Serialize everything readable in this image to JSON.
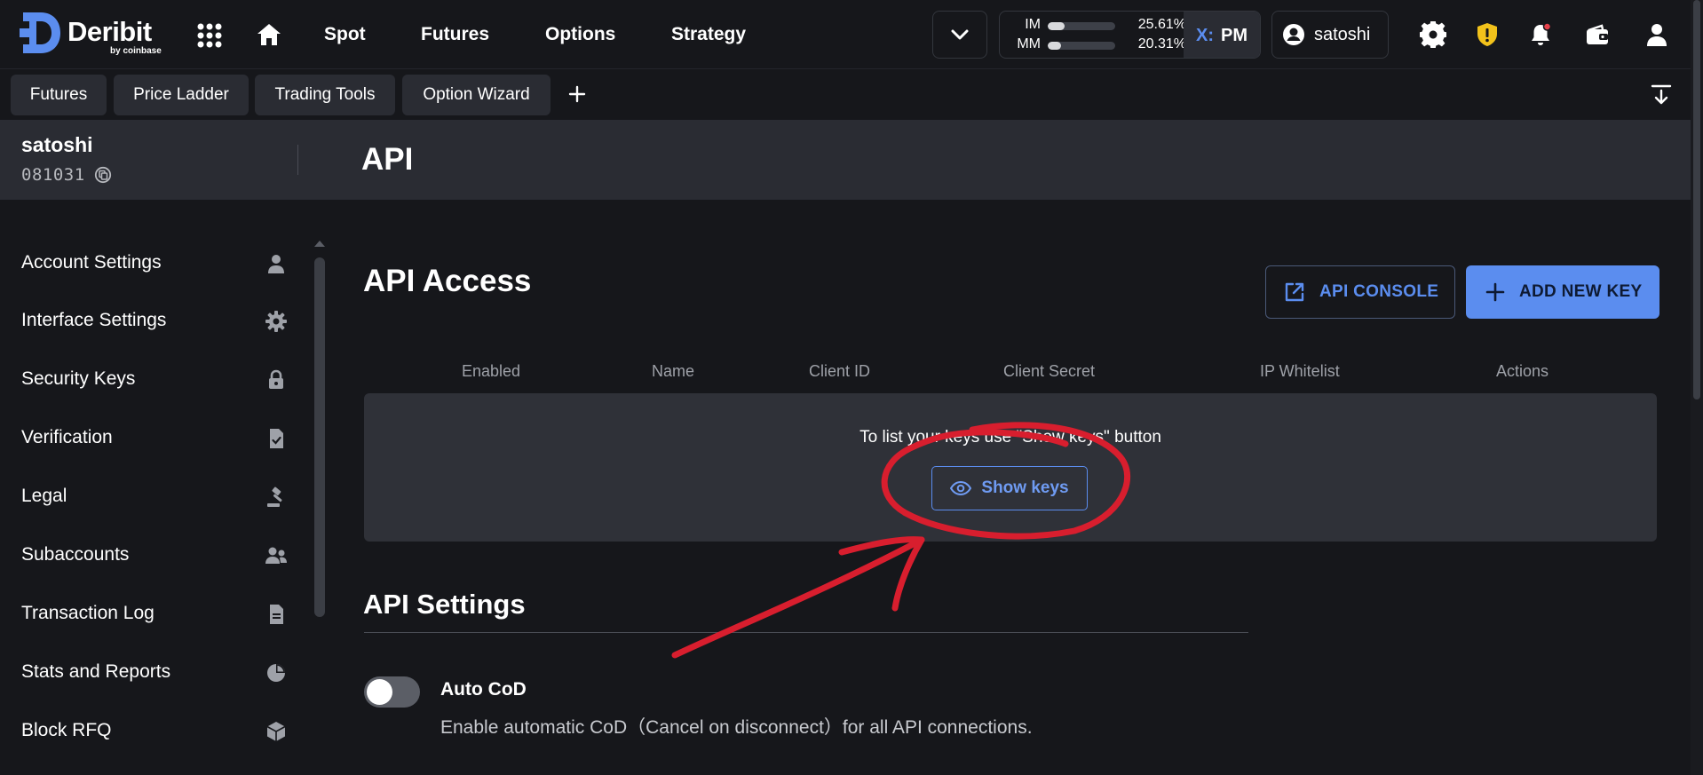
{
  "brand": {
    "name": "Deribit",
    "byline": "by coinbase",
    "accent": "#5b8def"
  },
  "nav": {
    "links": [
      "Spot",
      "Futures",
      "Options",
      "Strategy"
    ]
  },
  "margin": {
    "im_label": "IM",
    "im_value": "25.61%",
    "im_fill": 0.2561,
    "mm_label": "MM",
    "mm_value": "20.31%",
    "mm_fill": 0.2031,
    "mode_prefix": "X:",
    "mode": "PM"
  },
  "user": {
    "name": "satoshi"
  },
  "tabs": [
    "Futures",
    "Price Ladder",
    "Trading Tools",
    "Option Wizard"
  ],
  "account": {
    "name": "satoshi",
    "id": "081031"
  },
  "page": {
    "title": "API"
  },
  "sidebar": {
    "items": [
      {
        "label": "Account Settings",
        "icon": "user-icon"
      },
      {
        "label": "Interface Settings",
        "icon": "gear-icon"
      },
      {
        "label": "Security Keys",
        "icon": "lock-icon"
      },
      {
        "label": "Verification",
        "icon": "checked-document-icon"
      },
      {
        "label": "Legal",
        "icon": "gavel-icon"
      },
      {
        "label": "Subaccounts",
        "icon": "users-icon"
      },
      {
        "label": "Transaction Log",
        "icon": "document-icon"
      },
      {
        "label": "Stats and Reports",
        "icon": "pie-chart-icon"
      },
      {
        "label": "Block RFQ",
        "icon": "cube-icon"
      }
    ]
  },
  "api_access": {
    "title": "API Access",
    "console_label": "API CONSOLE",
    "add_label": "ADD NEW KEY",
    "columns": [
      "Enabled",
      "Name",
      "Client ID",
      "Client Secret",
      "IP Whitelist",
      "Actions"
    ],
    "empty_message": "To list your keys use \"Show keys\" button",
    "show_keys_label": "Show keys"
  },
  "api_settings": {
    "title": "API Settings",
    "auto_cod": {
      "title": "Auto CoD",
      "description": "Enable automatic CoD（Cancel on disconnect）for all API connections.",
      "enabled": false
    }
  },
  "annotation_color": "#d81e2e"
}
